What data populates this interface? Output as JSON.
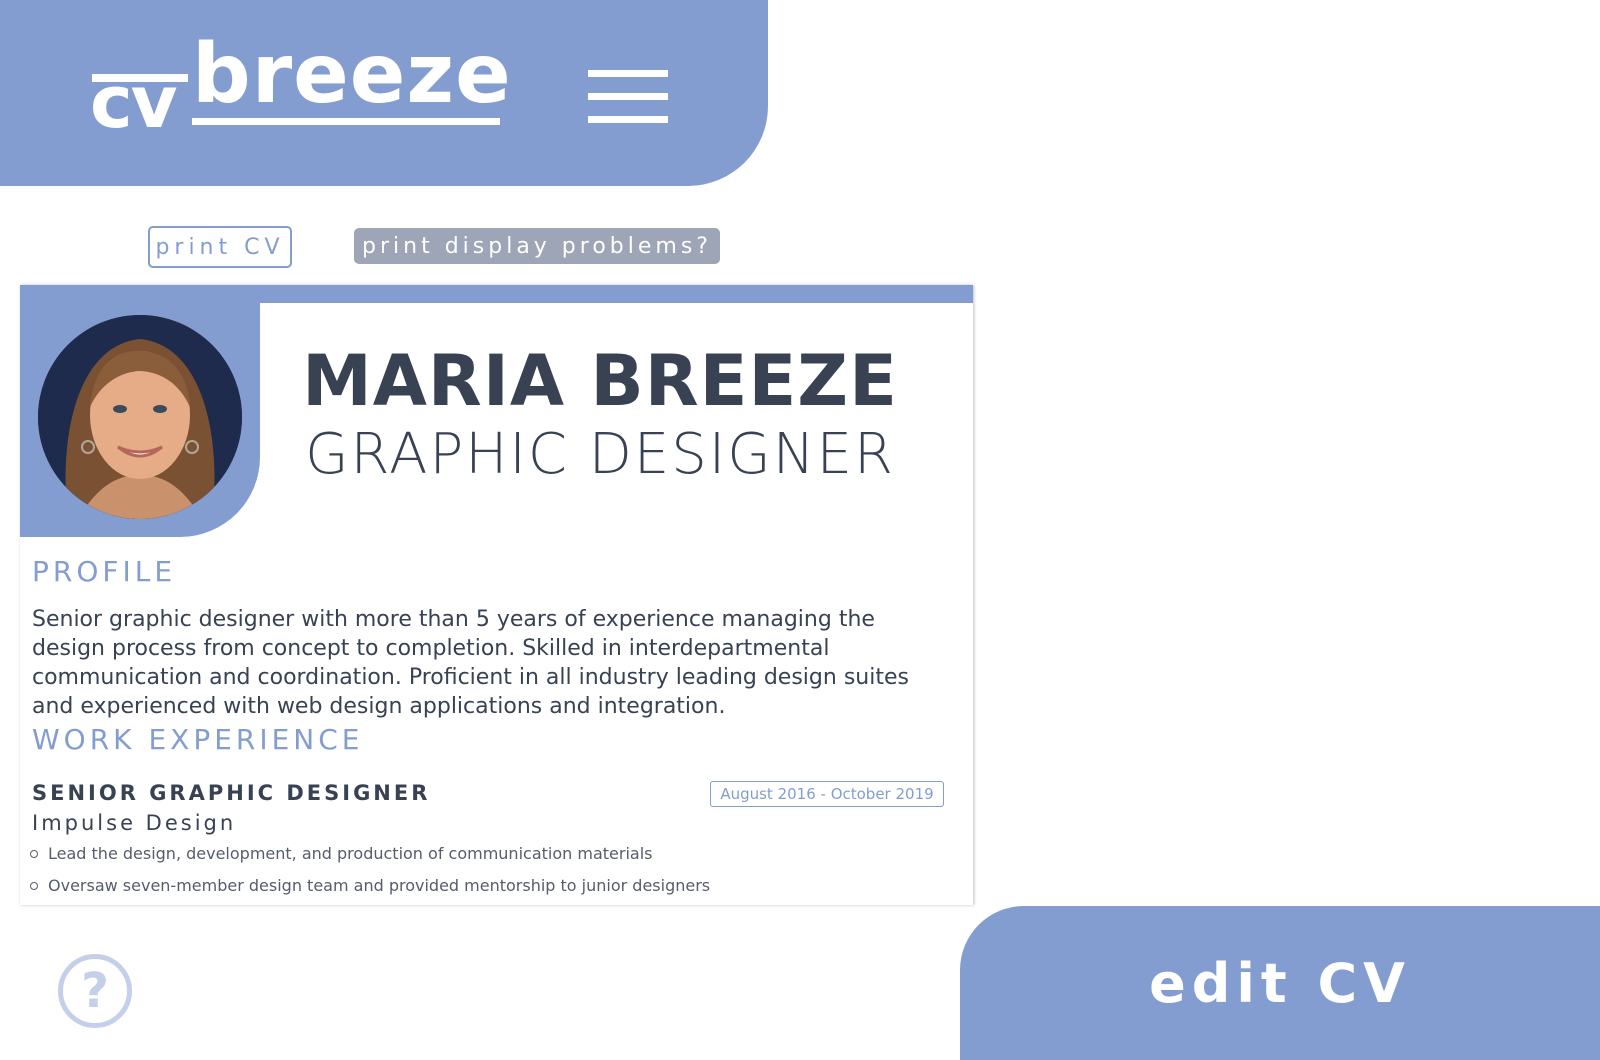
{
  "header": {
    "logo_cv": "cv",
    "logo_breeze": "breeze",
    "menu_icon": "hamburger-menu-icon"
  },
  "actions": {
    "print_label": "print CV",
    "problems_label": "print display problems?"
  },
  "cv": {
    "name": "MARIA BREEZE",
    "title": "GRAPHIC DESIGNER",
    "profile_heading": "PROFILE",
    "profile_text": "Senior graphic designer with more than 5 years of experience managing the design process from concept to completion. Skilled in interdepartmental communication and coordination. Proficient in all industry leading design suites and experienced with web design applications and integration.",
    "experience_heading": "WORK EXPERIENCE",
    "jobs": [
      {
        "role": "SENIOR GRAPHIC DESIGNER",
        "company": "Impulse Design",
        "dates": "August 2016 - October 2019",
        "bullets": [
          "Lead the design, development, and production of communication materials",
          "Oversaw seven-member design team and provided mentorship to junior designers"
        ]
      }
    ]
  },
  "help": {
    "icon": "help-icon",
    "glyph": "?"
  },
  "edit": {
    "label": "edit CV"
  },
  "colors": {
    "accent": "#849dd0",
    "text": "#384253",
    "muted_button": "#9ea5b6",
    "help_icon": "#c4cfea"
  }
}
